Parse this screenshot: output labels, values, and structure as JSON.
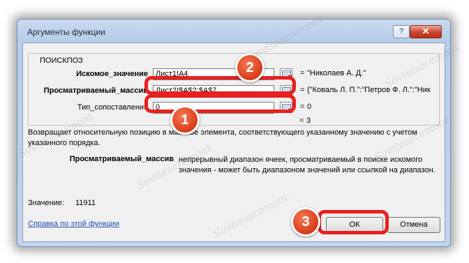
{
  "dialog": {
    "title": "Аргументы функции",
    "help_label": "?",
    "close_label": "✕",
    "function_name": "ПОИСКПОЗ",
    "args": [
      {
        "name": "Искомое_значение",
        "value": "Лист1!A4",
        "result": "\"Николаев А. Д.\""
      },
      {
        "name": "Просматриваемый_массив",
        "value": "Лист2!$A$2:$A$7",
        "result": "{\"Коваль Л. П.\":\"Петров Ф. Л.\":\"Ник"
      },
      {
        "name": "Тип_сопоставления",
        "value": "0",
        "result": "0"
      }
    ],
    "equals": "=",
    "total_result": "3",
    "description": "Возвращает относительную позицию в массиве элемента, соответствующего указанному значению с учетом указанного порядка.",
    "arg_help_name": "Просматриваемый_массив",
    "arg_help_text": "непрерывный диапазон ячеек, просматриваемый в поиске искомого значения - может быть диапазоном значений или ссылкой на диапазон.",
    "value_label": "Значение:",
    "value": "11911",
    "help_link": "Справка по этой функции",
    "ok_label": "ОК",
    "cancel_label": "Отмена"
  },
  "badges": [
    "1",
    "2",
    "3"
  ],
  "watermark": "Sovtiesaremont",
  "colors": {
    "highlight": "#e8201f",
    "badge": "#de4321",
    "link": "#1f4fb4"
  }
}
